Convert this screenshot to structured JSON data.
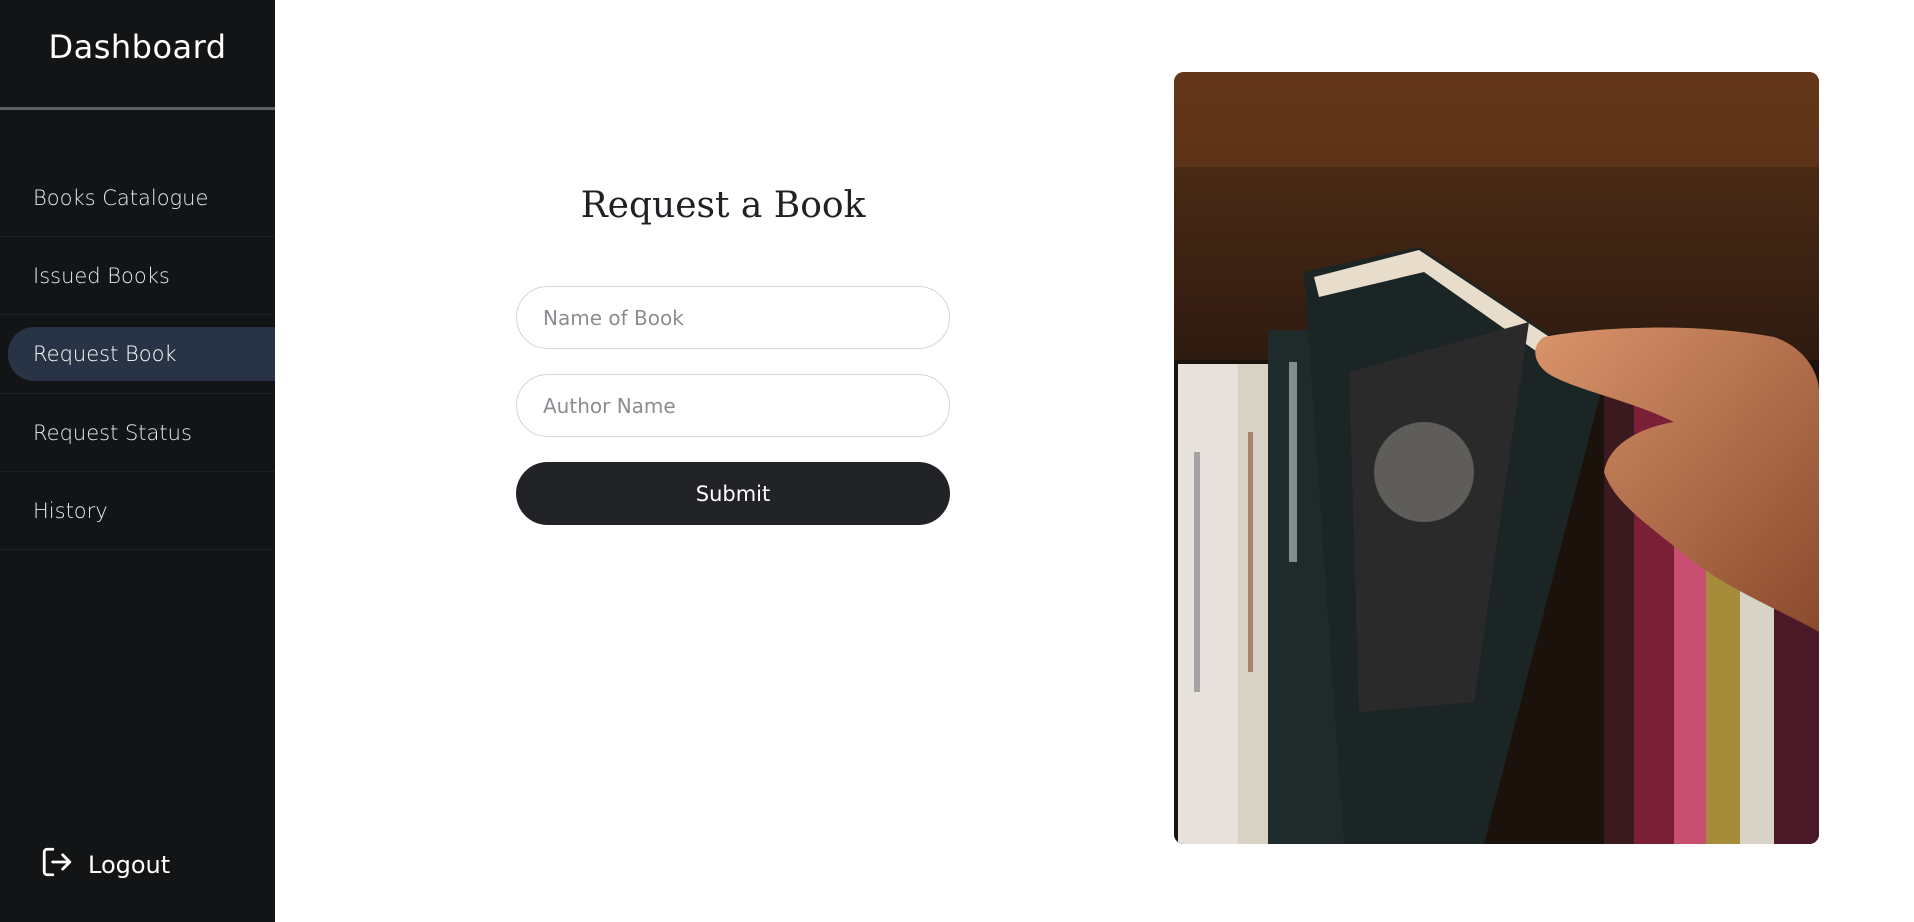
{
  "sidebar": {
    "brand": "Dashboard",
    "items": [
      {
        "label": "Books Catalogue"
      },
      {
        "label": "Issued Books"
      },
      {
        "label": "Request Book",
        "active": true
      },
      {
        "label": "Request Status"
      },
      {
        "label": "History"
      }
    ],
    "logout_label": "Logout",
    "logout_icon": "logout-icon"
  },
  "form": {
    "title": "Request a Book",
    "book_name": {
      "value": "",
      "placeholder": "Name of Book"
    },
    "author_name": {
      "value": "",
      "placeholder": "Author Name"
    },
    "submit_label": "Submit"
  },
  "colors": {
    "sidebar_bg": "#121416",
    "active_item_bg": "#283445",
    "button_bg": "#212327"
  }
}
